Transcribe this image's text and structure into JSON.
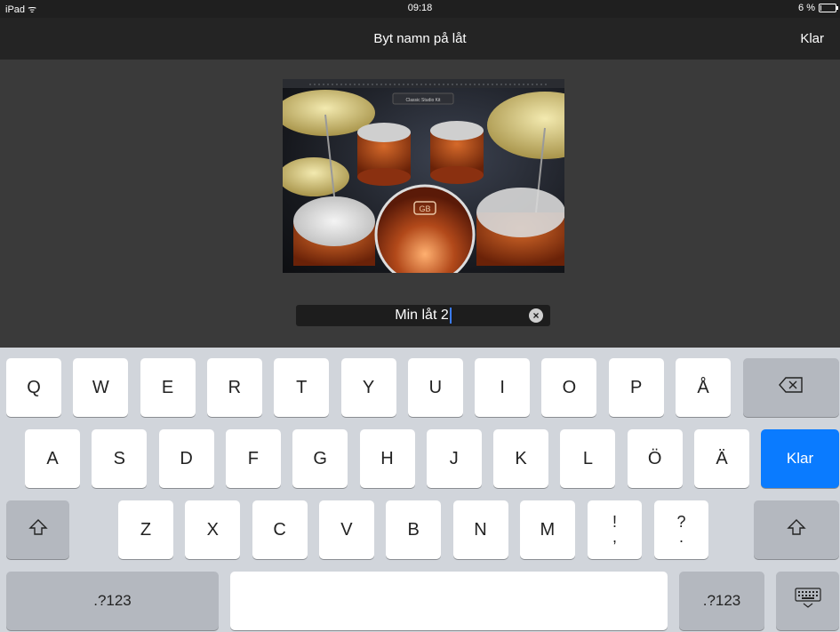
{
  "status_bar": {
    "device": "iPad",
    "time": "09:18",
    "battery": "6 %",
    "battery_level": 0.06
  },
  "nav": {
    "title": "Byt namn på låt",
    "done_label": "Klar"
  },
  "thumbnail": {
    "kit_label": "Classic Studio Kit",
    "drum_logo": "GB"
  },
  "name_field": {
    "value": "Min låt 2"
  },
  "keyboard": {
    "row1": [
      "Q",
      "W",
      "E",
      "R",
      "T",
      "Y",
      "U",
      "I",
      "O",
      "P",
      "Å"
    ],
    "row2": [
      "A",
      "S",
      "D",
      "F",
      "G",
      "H",
      "J",
      "K",
      "L",
      "Ö",
      "Ä"
    ],
    "row3": [
      "Z",
      "X",
      "C",
      "V",
      "B",
      "N",
      "M"
    ],
    "punct1": {
      "top": "!",
      "bottom": ","
    },
    "punct2": {
      "top": "?",
      "bottom": "."
    },
    "return_label": "Klar",
    "numbers_label": ".?123",
    "accent_color": "#0a7bff"
  }
}
